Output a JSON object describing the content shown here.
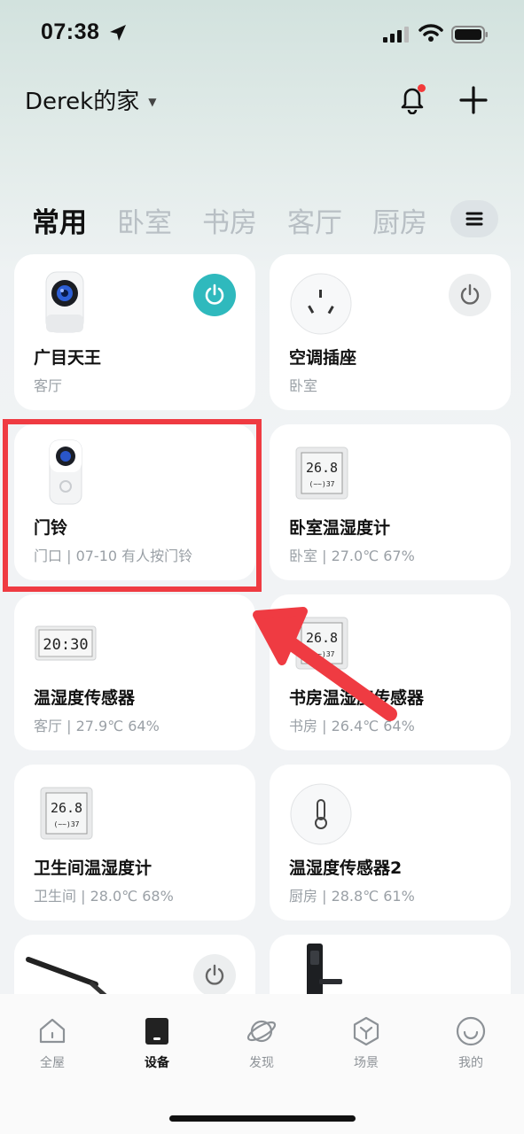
{
  "status_bar": {
    "time": "07:38"
  },
  "header": {
    "home_name": "Derek的家"
  },
  "tabs": [
    {
      "label": "常用",
      "active": true
    },
    {
      "label": "卧室"
    },
    {
      "label": "书房"
    },
    {
      "label": "客厅"
    },
    {
      "label": "厨房"
    }
  ],
  "devices": [
    {
      "name": "广目天王",
      "sub": "客厅",
      "icon": "camera-icon",
      "power": "on"
    },
    {
      "name": "空调插座",
      "sub": "卧室",
      "icon": "socket-icon",
      "power": "off"
    },
    {
      "name": "门铃",
      "sub": "门口 | 07-10 有人按门铃",
      "icon": "doorbell-icon"
    },
    {
      "name": "卧室温湿度计",
      "sub": "卧室 | 27.0℃ 67%",
      "icon": "thermometer-display-icon",
      "display": "26.8"
    },
    {
      "name": "温湿度传感器",
      "sub": "客厅 | 27.9℃ 64%",
      "icon": "clock-display-icon",
      "display": "20:30"
    },
    {
      "name": "书房温湿度传感器",
      "sub": "书房 | 26.4℃ 64%",
      "icon": "thermometer-display-icon",
      "display": "26.8"
    },
    {
      "name": "卫生间温湿度计",
      "sub": "卫生间 | 28.0℃ 68%",
      "icon": "thermometer-display-icon",
      "display": "26.8"
    },
    {
      "name": "温湿度传感器2",
      "sub": "厨房 | 28.8℃ 61%",
      "icon": "round-sensor-icon"
    },
    {
      "name": "",
      "sub": "",
      "icon": "monitor-light-bar-icon",
      "power": "off"
    },
    {
      "name": "",
      "sub": "",
      "icon": "smart-lock-icon"
    }
  ],
  "bottom_nav": [
    {
      "label": "全屋",
      "icon": "home-icon"
    },
    {
      "label": "设备",
      "icon": "device-icon",
      "active": true
    },
    {
      "label": "发现",
      "icon": "planet-icon"
    },
    {
      "label": "场景",
      "icon": "scene-icon"
    },
    {
      "label": "我的",
      "icon": "profile-icon"
    }
  ],
  "colors": {
    "accent": "#2fb9bd",
    "highlight": "#ef3b42",
    "notify_dot": "#f23a3a"
  }
}
